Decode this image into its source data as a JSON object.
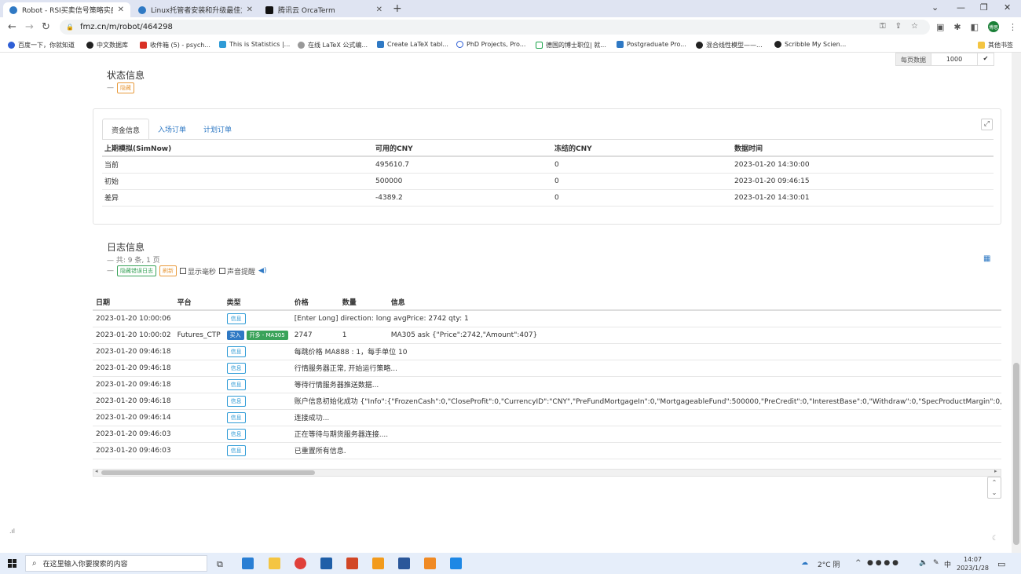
{
  "browser": {
    "tabs": [
      {
        "title": "Robot - RSI买卖信号策略实盘测",
        "active": true
      },
      {
        "title": "Linux托管者安装和升级最佳方法",
        "active": false
      },
      {
        "title": "腾讯云 OrcaTerm",
        "active": false
      }
    ],
    "url": "fmz.cn/m/robot/464298",
    "profile_initials": "博思",
    "bookmarks": [
      "百度一下，你就知道",
      "中文数据库",
      "收件箱 (5) - psych...",
      "This is Statistics |...",
      "在线 LaTeX 公式编...",
      "Create LaTeX tabl...",
      "PhD Projects, Pro...",
      "德国的博士职位| 就...",
      "Postgraduate Pro...",
      "混合线性模型——...",
      "Scribble My Scien...",
      "其他书签"
    ]
  },
  "per_page": {
    "label": "每页数据",
    "value": "1000"
  },
  "status": {
    "title": "状态信息",
    "prefix": "—",
    "hide_tag": "隐藏"
  },
  "fund": {
    "tabs": [
      "资金信息",
      "入场订单",
      "计划订单"
    ],
    "headers": [
      "上期模拟(SimNow)",
      "可用的CNY",
      "冻结的CNY",
      "数据时间"
    ],
    "rows": [
      {
        "label": "当前",
        "available": "495610.7",
        "frozen": "0",
        "time": "2023-01-20 14:30:00"
      },
      {
        "label": "初始",
        "available": "500000",
        "frozen": "0",
        "time": "2023-01-20 09:46:15"
      },
      {
        "label": "差异",
        "available": "-4389.2",
        "frozen": "0",
        "time": "2023-01-20 14:30:01"
      }
    ]
  },
  "log": {
    "title": "日志信息",
    "summary": "— 共: 9 条, 1 页",
    "prefix": "—",
    "hide_error_tag": "隐藏错误日志",
    "refresh_tag": "刷新",
    "show_ms": "显示毫秒",
    "sound_alert": "声音提醒",
    "headers": [
      "日期",
      "平台",
      "类型",
      "价格",
      "数量",
      "信息"
    ],
    "rows": [
      {
        "date": "2023-01-20 10:00:06",
        "platform": "",
        "type": "信息",
        "price": "[Enter Long] direction: long avgPrice: 2742 qty: 1",
        "qty": "",
        "info": ""
      },
      {
        "date": "2023-01-20 10:00:02",
        "platform": "Futures_CTP",
        "type": "买入",
        "type2": "开多 - MA305",
        "price": "2747",
        "qty": "1",
        "info": "MA305 ask {\"Price\":2742,\"Amount\":407}"
      },
      {
        "date": "2023-01-20 09:46:18",
        "platform": "",
        "type": "信息",
        "price": "每跳价格 MA888 : 1，每手单位 10",
        "qty": "",
        "info": ""
      },
      {
        "date": "2023-01-20 09:46:18",
        "platform": "",
        "type": "信息",
        "price": "行情服务器正常, 开始运行策略...",
        "qty": "",
        "info": ""
      },
      {
        "date": "2023-01-20 09:46:18",
        "platform": "",
        "type": "信息",
        "price": "等待行情服务器推送数据...",
        "qty": "",
        "info": ""
      },
      {
        "date": "2023-01-20 09:46:18",
        "platform": "",
        "type": "信息",
        "price": "账户信息初始化成功 {\"Info\":{\"FrozenCash\":0,\"CloseProfit\":0,\"CurrencyID\":\"CNY\",\"PreFundMortgageIn\":0,\"MortgageableFund\":500000,\"PreCredit\":0,\"InterestBase\":0,\"Withdraw\":0,\"SpecProductMargin\":0,\"RemainSwa",
        "qty": "",
        "info": ""
      },
      {
        "date": "2023-01-20 09:46:14",
        "platform": "",
        "type": "信息",
        "price": "连接成功...",
        "qty": "",
        "info": ""
      },
      {
        "date": "2023-01-20 09:46:03",
        "platform": "",
        "type": "信息",
        "price": "正在等待与期货服务器连接....",
        "qty": "",
        "info": ""
      },
      {
        "date": "2023-01-20 09:46:03",
        "platform": "",
        "type": "信息",
        "price": "已重置所有信息.",
        "qty": "",
        "info": ""
      }
    ]
  },
  "taskbar": {
    "search_placeholder": "在这里输入你要搜索的内容",
    "weather": "2°C 阴",
    "ime": "中",
    "time": "14:07",
    "date": "2023/1/28"
  }
}
